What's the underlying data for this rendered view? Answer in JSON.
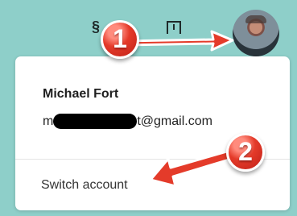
{
  "account": {
    "name": "Michael Fort",
    "email_visible_prefix": "m",
    "email_visible_suffix": "t@gmail.com"
  },
  "menu": {
    "switch_account_label": "Switch account"
  },
  "annotations": {
    "step_1": "1",
    "step_2": "2"
  },
  "colors": {
    "background": "#8ecfc9",
    "arrow_red": "#e43b2a",
    "text_dark": "#1f1f1f"
  }
}
